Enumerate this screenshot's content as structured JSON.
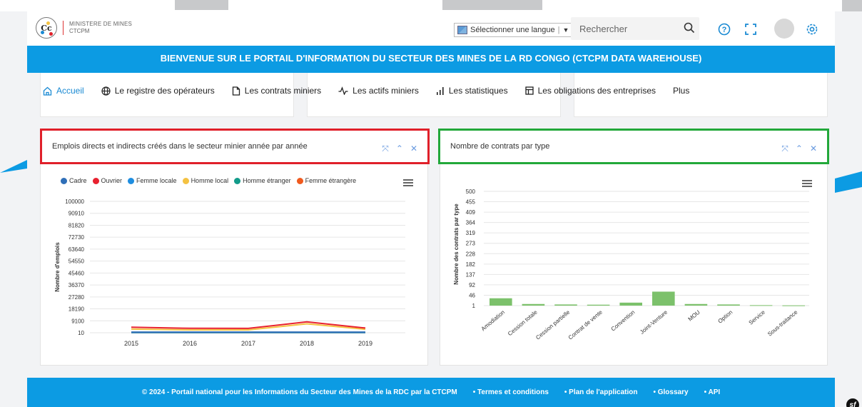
{
  "header": {
    "org_line1": "MINISTERE DE MINES",
    "org_line2": "CTCPM",
    "language_select": "Sélectionner une langue",
    "search_placeholder": "Rechercher"
  },
  "banner": {
    "title": "BIENVENUE SUR LE PORTAIL D'INFORMATION DU SECTEUR DES MINES DE LA RD CONGO (CTCPM DATA WAREHOUSE)"
  },
  "nav": {
    "items": [
      {
        "label": "Accueil",
        "icon": "home-icon",
        "active": true
      },
      {
        "label": "Le registre des opérateurs",
        "icon": "globe-icon"
      },
      {
        "label": "Les contrats miniers",
        "icon": "document-icon"
      },
      {
        "label": "Les actifs miniers",
        "icon": "pulse-icon"
      },
      {
        "label": "Les statistiques",
        "icon": "bar-stats-icon"
      },
      {
        "label": "Les obligations des entreprises",
        "icon": "window-icon"
      },
      {
        "label": "Plus",
        "icon": ""
      }
    ]
  },
  "colors": {
    "brand_blue": "#0c9be3",
    "highlight_red": "#e0202a",
    "highlight_green": "#22a83a",
    "bar_green": "#7cc16b"
  },
  "panels": {
    "left_title": "Emplois directs et indirects créés dans le secteur minier année par année",
    "right_title": "Nombre de contrats par type"
  },
  "chart_data": [
    {
      "type": "line",
      "title": "Emplois directs et indirects créés dans le secteur minier année par année",
      "xlabel": "",
      "ylabel": "Nombre d'emplois",
      "x": [
        "2015",
        "2016",
        "2017",
        "2018",
        "2019"
      ],
      "y_ticks": [
        "100000",
        "90910",
        "81820",
        "72730",
        "63640",
        "54550",
        "45460",
        "36370",
        "27280",
        "18190",
        "9100",
        "10"
      ],
      "ylim": [
        10,
        100000
      ],
      "legend": "top",
      "series": [
        {
          "name": "Cadre",
          "color": "#2f6fb8",
          "values": [
            500,
            500,
            500,
            500,
            500
          ]
        },
        {
          "name": "Ouvrier",
          "color": "#e8212f",
          "values": [
            4200,
            3400,
            3300,
            8300,
            3600
          ]
        },
        {
          "name": "Femme locale",
          "color": "#1f8ee0",
          "values": [
            300,
            300,
            300,
            300,
            300
          ]
        },
        {
          "name": "Homme local",
          "color": "#f4c242",
          "values": [
            2800,
            2200,
            2200,
            6800,
            2600
          ]
        },
        {
          "name": "Homme étranger",
          "color": "#129b8a",
          "values": [
            200,
            200,
            200,
            200,
            200
          ]
        },
        {
          "name": "Femme étrangère",
          "color": "#f05a1e",
          "values": [
            100,
            100,
            100,
            100,
            100
          ]
        }
      ]
    },
    {
      "type": "bar",
      "title": "Nombre de contrats par type",
      "xlabel": "",
      "ylabel": "Nombre des contrats par type",
      "categories": [
        "Amodiation",
        "Cession totale",
        "Cession partielle",
        "Contrat de vente",
        "Convention",
        "Joint-Venture",
        "MOU",
        "Option",
        "Service",
        "Sous-traitance"
      ],
      "values": [
        33,
        8,
        6,
        5,
        14,
        62,
        8,
        6,
        3,
        2
      ],
      "y_ticks": [
        "500",
        "455",
        "409",
        "364",
        "319",
        "273",
        "228",
        "182",
        "137",
        "92",
        "46",
        "1"
      ],
      "ylim": [
        1,
        500
      ]
    }
  ]
}
